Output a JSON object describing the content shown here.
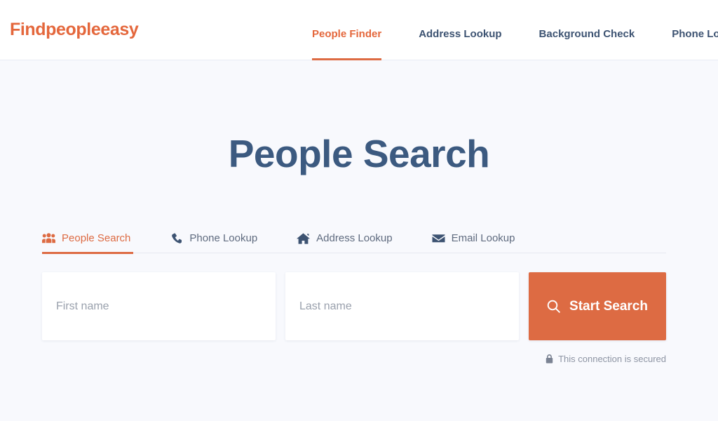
{
  "brand": {
    "logo_text": "Findpeopleeasy",
    "logo_color": "#e4673c"
  },
  "header": {
    "nav_items": [
      {
        "label": "People Finder",
        "active": true
      },
      {
        "label": "Address Lookup",
        "active": false
      },
      {
        "label": "Background Check",
        "active": false
      },
      {
        "label": "Phone Lookup",
        "active": false
      }
    ],
    "nav_color": "#3d5372",
    "active_color": "#e4673c"
  },
  "main": {
    "page_title": "People Search",
    "title_color": "#3c5a80",
    "tabs": [
      {
        "label": "People Search",
        "icon": "users-icon",
        "active": true
      },
      {
        "label": "Phone Lookup",
        "icon": "phone-icon",
        "active": false
      },
      {
        "label": "Address Lookup",
        "icon": "home-icon",
        "active": false
      },
      {
        "label": "Email Lookup",
        "icon": "envelope-icon",
        "active": false
      }
    ],
    "search": {
      "first_name_value": "",
      "first_name_placeholder": "First name",
      "last_name_value": "",
      "last_name_placeholder": "Last name",
      "submit_label": "Start Search",
      "submit_icon": "search-icon",
      "submit_color": "#dd6b43"
    },
    "secured_note": {
      "icon": "lock-icon",
      "text": "This connection is secured"
    }
  }
}
